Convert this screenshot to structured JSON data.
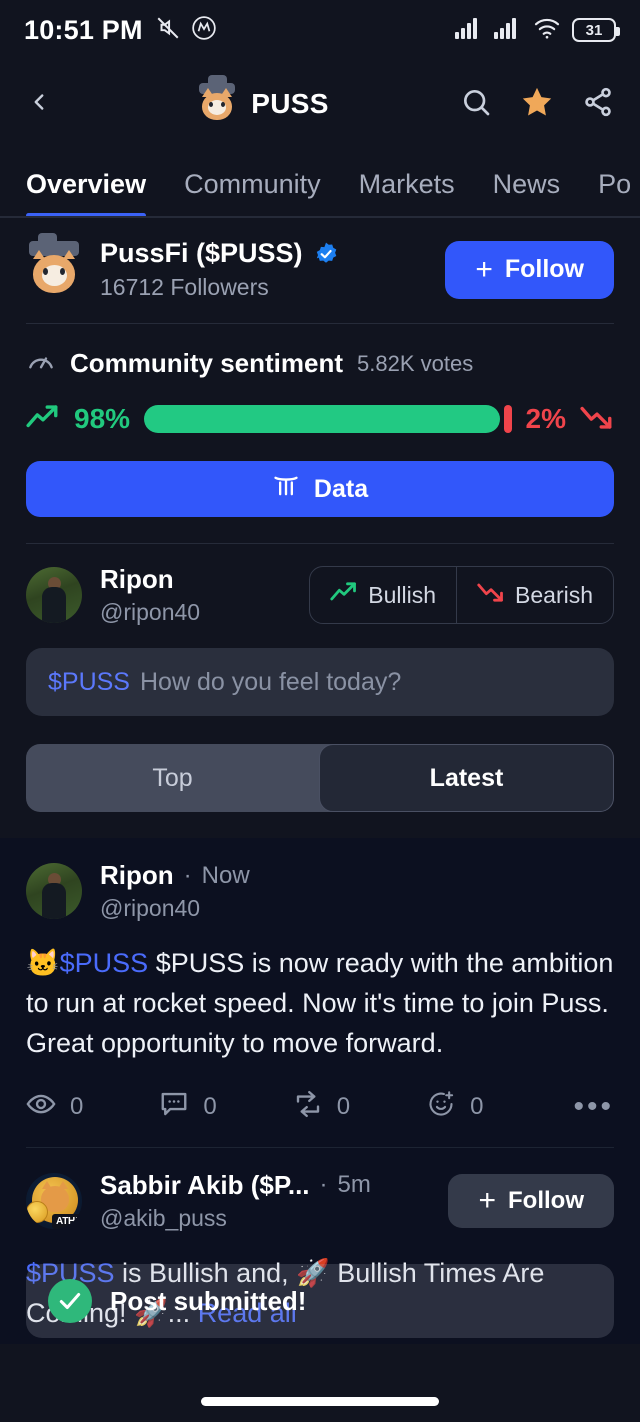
{
  "status_bar": {
    "time": "10:51 PM",
    "icons": [
      "mute-icon",
      "app-badge-icon",
      "signal-icon",
      "signal-2-icon",
      "wifi-icon"
    ],
    "battery_level": "31"
  },
  "header": {
    "back_icon": "chevron-left-icon",
    "title": "PUSS",
    "avatar": "cat-with-hat-avatar",
    "actions": [
      "search-icon",
      "star-icon",
      "share-icon"
    ],
    "star_color": "#f0a859"
  },
  "tabs": {
    "items": [
      {
        "label": "Overview",
        "active": true
      },
      {
        "label": "Community",
        "active": false
      },
      {
        "label": "Markets",
        "active": false
      },
      {
        "label": "News",
        "active": false
      },
      {
        "label": "Po",
        "active": false
      }
    ],
    "active_color": "#3b62f6"
  },
  "profile": {
    "name": "PussFi ($PUSS)",
    "verified": true,
    "followers": "16712 Followers",
    "follow_label": "Follow",
    "follow_plus": "+",
    "follow_color": "#3257fa"
  },
  "sentiment": {
    "title": "Community sentiment",
    "votes": "5.82K votes",
    "bullish_pct": "98%",
    "bearish_pct": "2%",
    "bullish_value": 98,
    "bearish_value": 2,
    "bullish_color": "#22c983",
    "bearish_color": "#f0444b",
    "data_button": "Data"
  },
  "composer": {
    "user": {
      "name": "Ripon",
      "handle": "@ripon40"
    },
    "bullish_label": "Bullish",
    "bearish_label": "Bearish",
    "cashtag": "$PUSS",
    "placeholder": "How do you feel today?"
  },
  "feed_filter": {
    "options": [
      {
        "label": "Top",
        "active": false
      },
      {
        "label": "Latest",
        "active": true
      }
    ]
  },
  "posts": [
    {
      "author": "Ripon",
      "handle": "@ripon40",
      "time": "Now",
      "separator": "·",
      "avatar": "ripon-photo-avatar",
      "emoji": "🐱",
      "cashtag": "$PUSS",
      "body": "$PUSS is now ready with the ambition to run at rocket speed. Now it's time to join Puss.  Great opportunity to move forward.",
      "actions": [
        {
          "icon": "eye-icon",
          "count": "0"
        },
        {
          "icon": "comment-icon",
          "count": "0"
        },
        {
          "icon": "repost-icon",
          "count": "0"
        },
        {
          "icon": "reaction-icon",
          "count": "0"
        }
      ],
      "more_icon": "more-dots-icon"
    },
    {
      "author": "Sabbir Akib ($P...",
      "handle": "@akib_puss",
      "time": "5m",
      "separator": "·",
      "avatar": "akib-coin-cat-avatar",
      "avatar_badge": "ATH!",
      "cashtag": "$PUSS",
      "body_part1": " is Bullish and, 🚀 Bullish Times Are Coming! 🚀...",
      "read_all": "Read all",
      "follow_label": "Follow",
      "follow_plus": "+"
    }
  ],
  "toast": {
    "message": "Post submitted!",
    "icon": "check-circle-icon",
    "icon_color": "#2fb87b"
  }
}
